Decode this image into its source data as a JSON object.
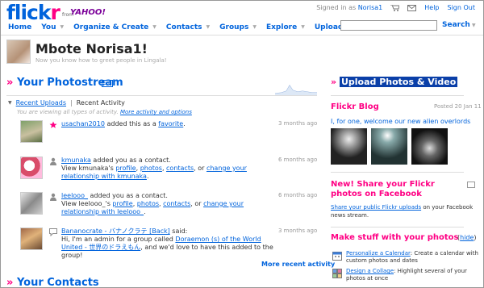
{
  "header": {
    "logo_left": "flick",
    "logo_right": "r",
    "from_text": "from",
    "yahoo_text": "YAHOO!",
    "signed_in_prefix": "Signed in as",
    "signed_in_user": "Norisa1",
    "help": "Help",
    "sign_out": "Sign Out",
    "search_label": "Search"
  },
  "nav": [
    {
      "label": "Home",
      "caret": false
    },
    {
      "label": "You",
      "caret": true
    },
    {
      "label": "Organize & Create",
      "caret": true
    },
    {
      "label": "Contacts",
      "caret": true
    },
    {
      "label": "Groups",
      "caret": true
    },
    {
      "label": "Explore",
      "caret": true
    },
    {
      "label": "Upload",
      "caret": false
    }
  ],
  "profile": {
    "greeting": "Mbote Norisa1!",
    "subtitle": "Now you know how to greet people in Lingala!"
  },
  "photostream": {
    "title": "Your Photostream",
    "pro_badge": "pro",
    "tab_recent_uploads": "Recent Uploads",
    "tab_separator": "|",
    "tab_recent_activity": "Recent Activity",
    "viewing_prefix": "You are viewing all types of activity.",
    "viewing_link": "More activity and options"
  },
  "activity": [
    {
      "user": "usachan2010",
      "text": " added this as a ",
      "link": "favorite",
      "tail": ".",
      "ago": "3 months ago"
    },
    {
      "user": "kmunaka",
      "text": " added you as a contact.",
      "line2_prefix": "View kmunaka's ",
      "l_profile": "profile",
      "l_photos": "photos",
      "l_contacts": "contacts",
      "or": ", or ",
      "l_change": "change your relationship with kmunaka",
      "tail": ".",
      "ago": "6 months ago"
    },
    {
      "user": "leelooo_",
      "text": " added you as a contact.",
      "line2_prefix": "View leelooo_'s ",
      "l_profile": "profile",
      "l_photos": "photos",
      "l_contacts": "contacts",
      "or": ", or ",
      "l_change": "change your relationship with leelooo_",
      "tail": ".",
      "ago": "6 months ago"
    },
    {
      "user": "Bananocrate - バナノクラテ [Back]",
      "text": " said:",
      "line2_prefix": "Hi, I'm an admin for a group called ",
      "group_link": "Doraemon (s) of the World United - 世界のドラえもん",
      "line2_tail": ", and we'd love to have this added to the group!",
      "ago": "3 months ago"
    }
  ],
  "more_recent_activity": "More recent activity",
  "contacts_title": "Your Contacts",
  "right": {
    "upload_title": "Upload Photos & Video",
    "blog_title": "Flickr Blog",
    "blog_date": "Posted 20 Jan 11",
    "blog_link": "I, for one, welcome our new alien overlords",
    "share_title": "New! Share your Flickr photos on Facebook",
    "share_link": "Share your public Flickr uploads",
    "share_tail": " on your Facebook news stream.",
    "make_title": "Make stuff with your photos",
    "hide_open": "(",
    "hide": "hide",
    "hide_close": ")",
    "make_items": [
      {
        "link": "Personalize a Calendar",
        "text": ": Create a calendar with custom photos and dates"
      },
      {
        "link": "Design a Collage",
        "text": ": Highlight several of your photos at once"
      }
    ]
  },
  "colors": {
    "brand_blue": "#0063dc",
    "brand_pink": "#ff0084"
  }
}
